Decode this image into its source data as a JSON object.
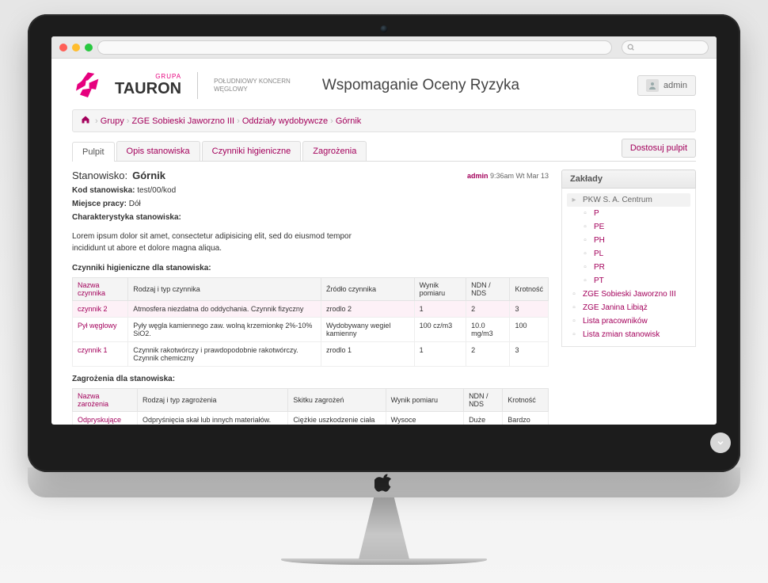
{
  "logo": {
    "grupa": "GRUPA",
    "name": "TAURON",
    "tagline1": "POŁUDNIOWY KONCERN",
    "tagline2": "WĘGLOWY"
  },
  "app_title": "Wspomaganie Oceny Ryzyka",
  "user": {
    "name": "admin"
  },
  "breadcrumb": [
    "Grupy",
    "ZGE Sobieski Jaworzno III",
    "Oddziały wydobywcze",
    "Górnik"
  ],
  "tabs": [
    "Pulpit",
    "Opis stanowiska",
    "Czynniki higieniczne",
    "Zagrożenia"
  ],
  "customize_btn": "Dostosuj pulpit",
  "position": {
    "label": "Stanowisko:",
    "value": "Górnik"
  },
  "metaline": {
    "user": "admin",
    "time": "9:36am Wt Mar 13"
  },
  "kv": {
    "kod_label": "Kod stanowiska:",
    "kod_val": "test/00/kod",
    "miejsce_label": "Miejsce pracy:",
    "miejsce_val": "Dół",
    "char_label": "Charakterystyka stanowiska:"
  },
  "desc": "Lorem ipsum dolor sit amet, consectetur adipisicing elit, sed do eiusmod tempor incididunt ut abore et dolore magna aliqua.",
  "hygiene_heading": "Czynniki higieniczne dla stanowiska:",
  "hygiene_cols": [
    "Nazwa czynnika",
    "Rodzaj i typ czynnika",
    "Źródło czynnika",
    "Wynik pomiaru",
    "NDN / NDS",
    "Krotność"
  ],
  "hygiene_rows": [
    {
      "name": "czynnik 2",
      "type": "Atmosfera niezdatna do oddychania. Czynnik fizyczny",
      "src": "zrodlo 2",
      "res": "1",
      "ndn": "2",
      "k": "3",
      "hl": true
    },
    {
      "name": "Pył węglowy",
      "type": "Pyły węgla kamiennego zaw. wolną krzemionkę 2%-10% SiO2.",
      "src": "Wydobywany wegiel kamienny",
      "res": "100 cz/m3",
      "ndn": "10.0 mg/m3",
      "k": "100"
    },
    {
      "name": "czynnik 1",
      "type": "Czynnik rakotwórczy i prawdopodobnie rakotwórczy. Czynnik chemiczny",
      "src": "zrodlo 1",
      "res": "1",
      "ndn": "2",
      "k": "3"
    }
  ],
  "hazard_heading": "Zagrożenia dla stanowiska:",
  "hazard_cols": [
    "Nazwa zarożenia",
    "Rodzaj i typ zagrożenia",
    "Skitku zagrożeń",
    "Wynik pomiaru",
    "NDN / NDS",
    "Krotność"
  ],
  "hazard_rows": [
    {
      "name": "Odpryskujące skały",
      "type": "Odpryśnięcia skał lub innych materiałów. Zagrożenia techniczne.",
      "eff": "Ciężkie uszkodzenie ciała lub śmierć.",
      "res": "Wysoce prawdopodobne",
      "ndn": "Duże",
      "k": "Bardzo duże"
    }
  ],
  "sidebar": {
    "title": "Zakłady",
    "nodes": [
      {
        "type": "folder",
        "label": "PKW S. A. Centrum"
      },
      {
        "type": "leaf",
        "label": "P",
        "lvl": 1
      },
      {
        "type": "leaf",
        "label": "PE",
        "lvl": 1
      },
      {
        "type": "leaf",
        "label": "PH",
        "lvl": 1
      },
      {
        "type": "leaf",
        "label": "PL",
        "lvl": 1
      },
      {
        "type": "leaf",
        "label": "PR",
        "lvl": 1
      },
      {
        "type": "leaf",
        "label": "PT",
        "lvl": 1
      },
      {
        "type": "leaf",
        "label": "ZGE Sobieski Jaworzno III"
      },
      {
        "type": "leaf",
        "label": "ZGE Janina Libiąż"
      },
      {
        "type": "leaf",
        "label": "Lista pracowników"
      },
      {
        "type": "leaf",
        "label": "Lista zmian stanowisk"
      }
    ]
  }
}
